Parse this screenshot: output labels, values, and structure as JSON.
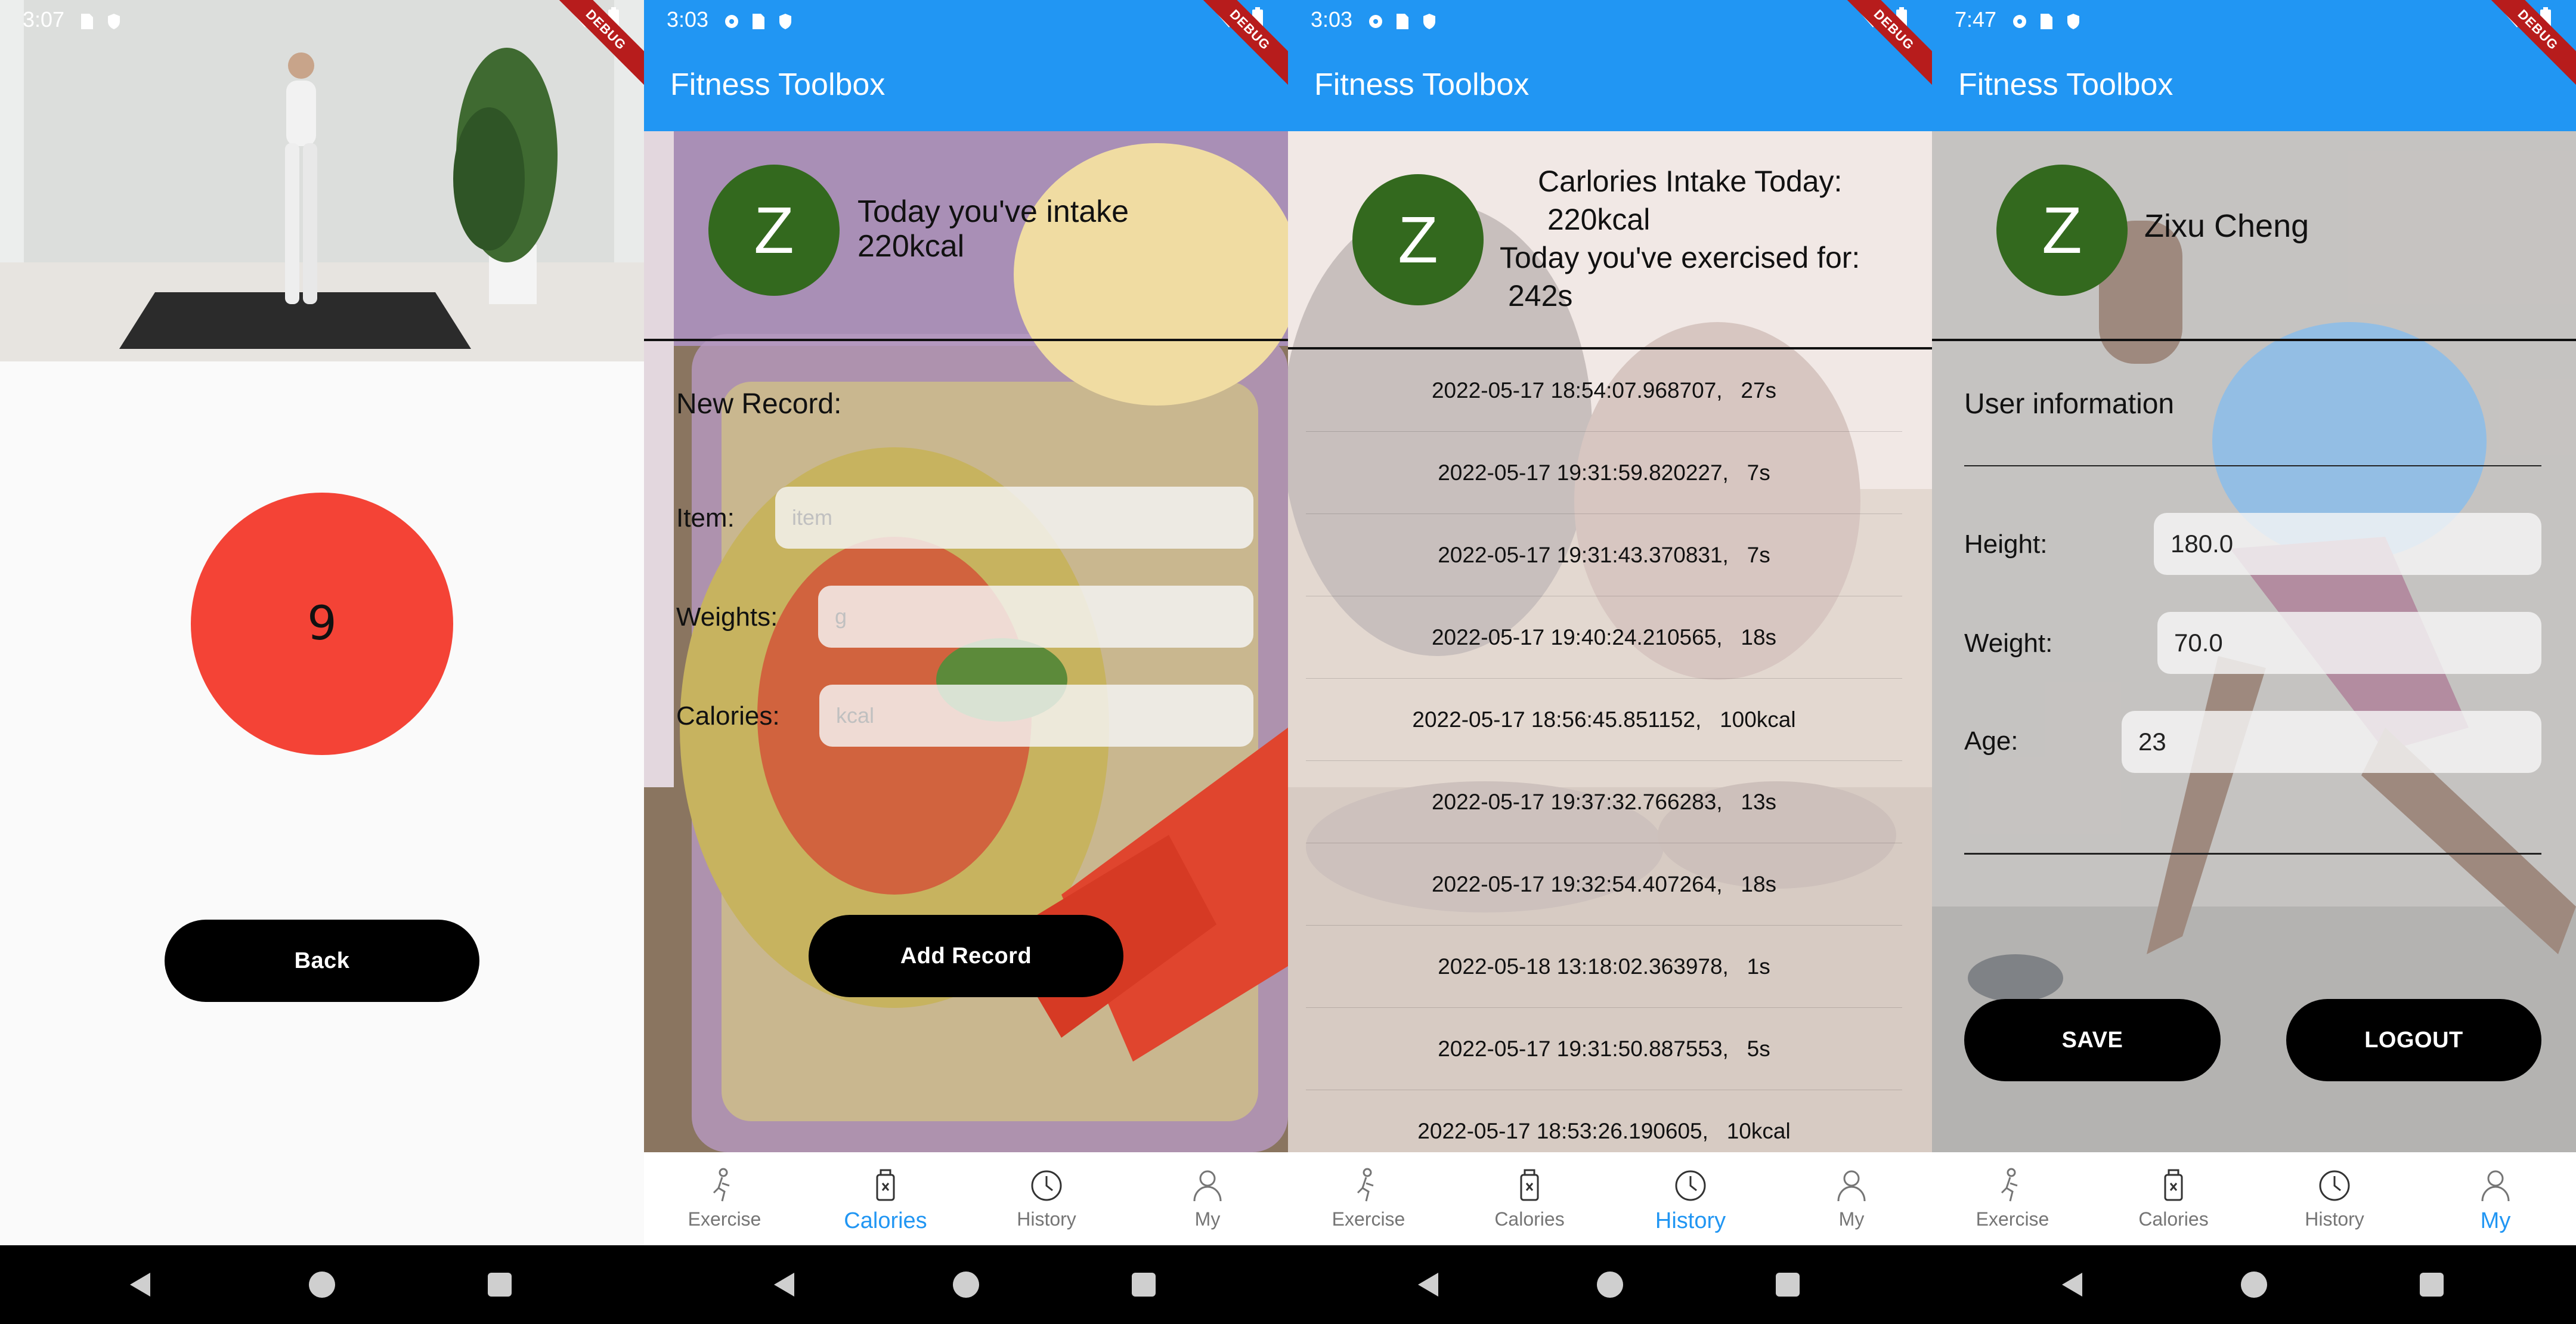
{
  "panel1": {
    "status": {
      "time": "3:07"
    },
    "countdown": "9",
    "back_label": "Back"
  },
  "panel2": {
    "status": {
      "time": "3:03"
    },
    "app_title": "Fitness Toolbox",
    "avatar_letter": "Z",
    "summary": "Today you've intake\n 220kcal",
    "new_record_label": "New Record:",
    "item_label": "Item:",
    "item_placeholder": "item",
    "weights_label": "Weights:",
    "weights_placeholder": "g",
    "calories_label": "Calories:",
    "calories_placeholder": "kcal",
    "add_record_label": "Add Record"
  },
  "panel3": {
    "status": {
      "time": "3:03"
    },
    "app_title": "Fitness Toolbox",
    "avatar_letter": "Z",
    "summary_line1": "Carlories Intake Today:",
    "summary_line2": "220kcal",
    "summary_line3": "Today you've exercised for:",
    "summary_line4": "242s",
    "history": [
      "2022-05-17 18:54:07.968707,   27s",
      "2022-05-17 19:31:59.820227,   7s",
      "2022-05-17 19:31:43.370831,   7s",
      "2022-05-17 19:40:24.210565,   18s",
      "2022-05-17 18:56:45.851152,   100kcal",
      "2022-05-17 19:37:32.766283,   13s",
      "2022-05-17 19:32:54.407264,   18s",
      "2022-05-18 13:18:02.363978,   1s",
      "2022-05-17 19:31:50.887553,   5s",
      "2022-05-17 18:53:26.190605,   10kcal"
    ]
  },
  "panel4": {
    "status": {
      "time": "7:47"
    },
    "app_title": "Fitness Toolbox",
    "avatar_letter": "Z",
    "user_name": "Zixu Cheng",
    "section_label": "User information",
    "height_label": "Height:",
    "height_value": "180.0",
    "weight_label": "Weight:",
    "weight_value": "70.0",
    "age_label": "Age:",
    "age_value": "23",
    "save_label": "SAVE",
    "logout_label": "LOGOUT"
  },
  "debug_banner": "DEBUG",
  "nav": {
    "exercise": "Exercise",
    "calories": "Calories",
    "history": "History",
    "my": "My"
  },
  "colors": {
    "primary": "#2196f3",
    "avatar": "#33691e",
    "countdown_circle": "#f44336",
    "button": "#000000"
  }
}
